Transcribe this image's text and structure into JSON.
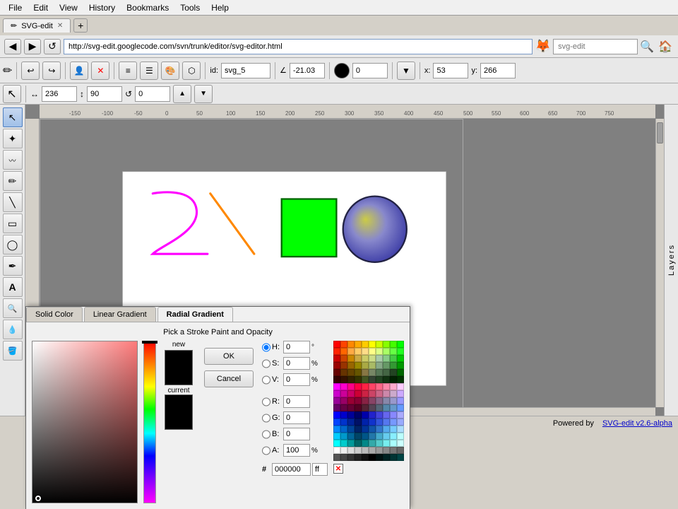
{
  "menubar": {
    "items": [
      "File",
      "Edit",
      "View",
      "History",
      "Bookmarks",
      "Tools",
      "Help"
    ]
  },
  "browser": {
    "tab_title": "SVG-edit",
    "tab_favicon": "✏",
    "new_tab_icon": "+",
    "url": "http://svg-edit.googlecode.com/svn/trunk/editor/svg-editor.html",
    "search_placeholder": "svg-edit",
    "back_icon": "◀",
    "forward_icon": "▶",
    "reload_icon": "↺",
    "home_icon": "🏠"
  },
  "editor_toolbar": {
    "title": "SVG-edit",
    "id_label": "id:",
    "id_value": "svg_5",
    "angle_label": "∠",
    "angle_value": "-21.03",
    "fill_color": "#000000",
    "opacity_value": "0",
    "x_label": "x:",
    "x_value": "53",
    "y_label": "y:",
    "y_value": "266",
    "width_value": "236",
    "height_value": "90",
    "rotate_value": "0"
  },
  "toolbox": {
    "tools": [
      {
        "name": "select",
        "icon": "↖",
        "active": true
      },
      {
        "name": "node-edit",
        "icon": "⬡"
      },
      {
        "name": "tweak",
        "icon": "〰"
      },
      {
        "name": "pencil",
        "icon": "✏"
      },
      {
        "name": "line",
        "icon": "╲"
      },
      {
        "name": "rect",
        "icon": "▭"
      },
      {
        "name": "ellipse",
        "icon": "◯"
      },
      {
        "name": "path",
        "icon": "✒"
      },
      {
        "name": "text",
        "icon": "A"
      },
      {
        "name": "zoom",
        "icon": "🔍"
      },
      {
        "name": "eyedropper",
        "icon": "💧"
      },
      {
        "name": "paint-bucket",
        "icon": "🪣"
      }
    ]
  },
  "canvas": {
    "ruler_marks": [
      "-150",
      "-100",
      "-50",
      "0",
      "50",
      "100",
      "150",
      "200",
      "250",
      "300",
      "350",
      "400",
      "450",
      "500",
      "550",
      "600",
      "650",
      "700",
      "750"
    ],
    "background": "white"
  },
  "statusbar": {
    "text": "Powered by",
    "link": "SVG-edit v2.6-alpha"
  },
  "layers_panel": {
    "label": "Layers"
  },
  "color_dialog": {
    "tabs": [
      "Solid Color",
      "Linear Gradient",
      "Radial Gradient"
    ],
    "active_tab": 2,
    "title": "Pick a Stroke Paint and Opacity",
    "new_label": "new",
    "current_label": "current",
    "ok_label": "OK",
    "cancel_label": "Cancel",
    "h_label": "H:",
    "h_value": "0",
    "h_unit": "°",
    "s_label": "S:",
    "s_value": "0",
    "s_unit": "%",
    "v_label": "V:",
    "v_value": "0",
    "v_unit": "%",
    "r_label": "R:",
    "r_value": "0",
    "g_label": "G:",
    "g_value": "0",
    "b_label": "B:",
    "b_value": "0",
    "a_label": "A:",
    "a_value": "100",
    "a_unit": "%",
    "hex_label": "#",
    "hex_value": "000000",
    "hex_suffix": "ff",
    "swatches": [
      [
        "#ff0000",
        "#ff4400",
        "#ff8800",
        "#ffaa00",
        "#ffcc00",
        "#ffff00",
        "#ccff00",
        "#88ff00",
        "#44ff00",
        "#00ff00"
      ],
      [
        "#ff2200",
        "#ff6600",
        "#ffaa44",
        "#ffcc66",
        "#ffdd88",
        "#ffff88",
        "#ddff88",
        "#aaff66",
        "#66ff44",
        "#22ff22"
      ],
      [
        "#cc0000",
        "#cc4400",
        "#cc8800",
        "#ccaa44",
        "#cccc66",
        "#ccdd88",
        "#aaccaa",
        "#88cc88",
        "#44cc44",
        "#00cc00"
      ],
      [
        "#990000",
        "#993300",
        "#996600",
        "#998800",
        "#aaaa44",
        "#aabb66",
        "#88aa88",
        "#669966",
        "#339933",
        "#009900"
      ],
      [
        "#660000",
        "#663300",
        "#664400",
        "#665500",
        "#887744",
        "#778866",
        "#557755",
        "#446644",
        "#224422",
        "#006600"
      ],
      [
        "#330000",
        "#331100",
        "#332200",
        "#333300",
        "#445522",
        "#334433",
        "#224422",
        "#113311",
        "#002200",
        "#003300"
      ],
      [
        "#ff00ff",
        "#ff00cc",
        "#ff0088",
        "#ff0044",
        "#ff2244",
        "#ff4466",
        "#ff6688",
        "#ff88aa",
        "#ffaacc",
        "#ffccff"
      ],
      [
        "#cc00cc",
        "#cc0099",
        "#cc0066",
        "#cc0033",
        "#cc2244",
        "#cc4466",
        "#cc6688",
        "#cc88aa",
        "#ccaacc",
        "#ccaaff"
      ],
      [
        "#990099",
        "#990066",
        "#990033",
        "#880033",
        "#882244",
        "#884466",
        "#886688",
        "#8888aa",
        "#9999cc",
        "#9999ff"
      ],
      [
        "#660066",
        "#660044",
        "#660033",
        "#550022",
        "#552233",
        "#554455",
        "#556677",
        "#5588aa",
        "#6699cc",
        "#6699ff"
      ],
      [
        "#0000ff",
        "#0000cc",
        "#000099",
        "#000066",
        "#0000aa",
        "#2222cc",
        "#4444dd",
        "#6666ee",
        "#8888ff",
        "#aaaaff"
      ],
      [
        "#0044ff",
        "#0033cc",
        "#002299",
        "#001166",
        "#0022aa",
        "#1133cc",
        "#3355dd",
        "#5577ee",
        "#7799ff",
        "#99aaff"
      ],
      [
        "#0088ff",
        "#0066cc",
        "#004499",
        "#002266",
        "#003399",
        "#1155aa",
        "#3377cc",
        "#55aaee",
        "#77ccff",
        "#aaddff"
      ],
      [
        "#00ccff",
        "#0099cc",
        "#006699",
        "#004466",
        "#005588",
        "#2277aa",
        "#44aacc",
        "#66ccee",
        "#88eeff",
        "#bbffff"
      ],
      [
        "#00ffff",
        "#00cccc",
        "#009999",
        "#006666",
        "#008888",
        "#33aaaa",
        "#55cccc",
        "#77eeee",
        "#aaffff",
        "#ccffff"
      ],
      [
        "#ffffff",
        "#eeeeee",
        "#dddddd",
        "#cccccc",
        "#bbbbbb",
        "#aaaaaa",
        "#999999",
        "#888888",
        "#777777",
        "#666666"
      ],
      [
        "#555555",
        "#444444",
        "#333333",
        "#222222",
        "#111111",
        "#000000",
        "#001111",
        "#002222",
        "#003333",
        "#004444"
      ]
    ]
  }
}
